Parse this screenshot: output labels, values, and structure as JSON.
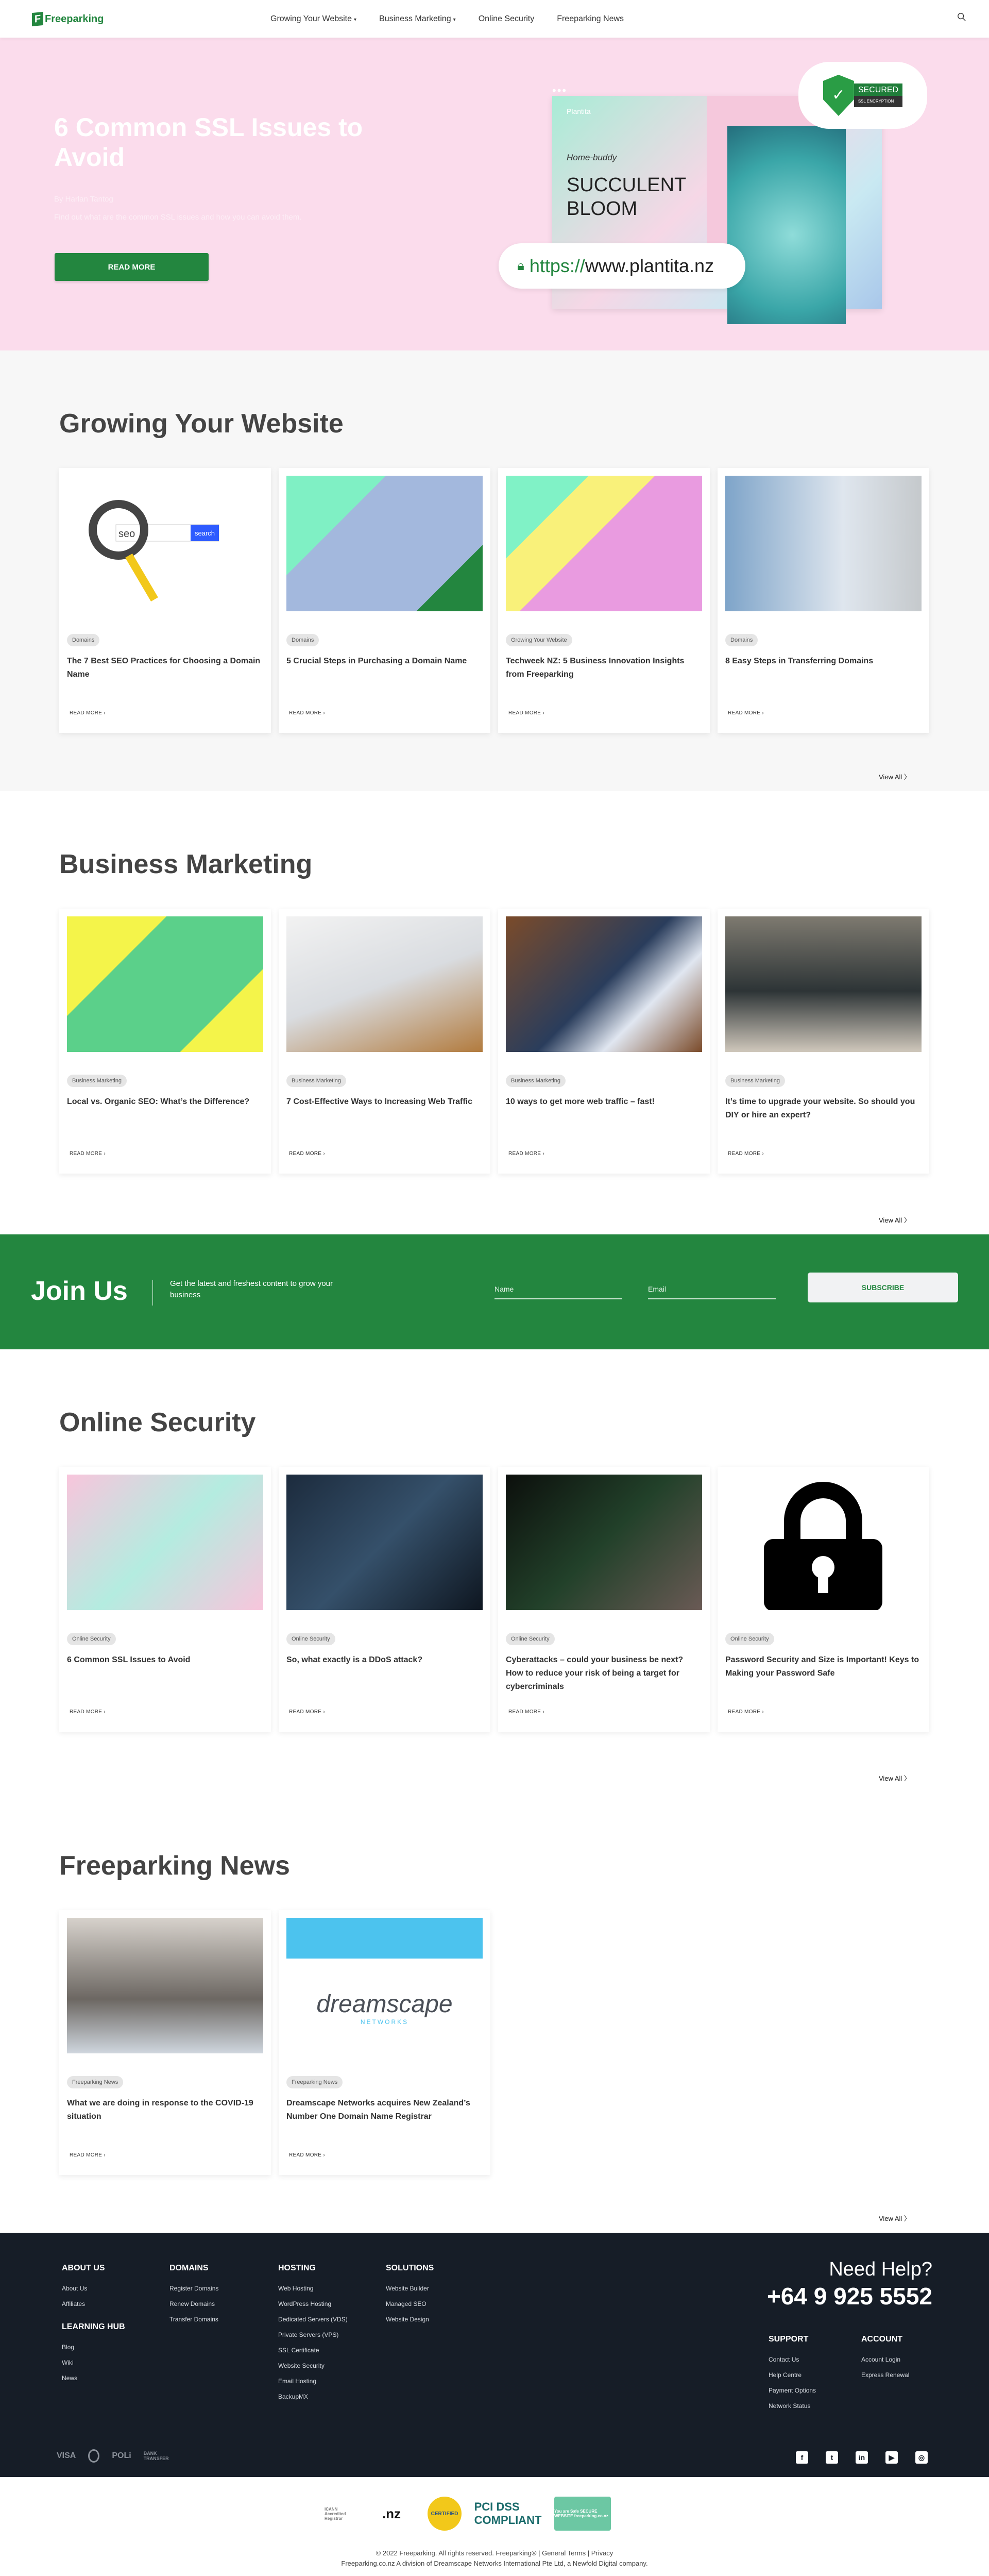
{
  "header": {
    "logo_mark": "F",
    "logo": "Freeparking",
    "nav": [
      {
        "label": "Growing Your Website",
        "dropdown": true
      },
      {
        "label": "Business Marketing",
        "dropdown": true
      },
      {
        "label": "Online Security",
        "dropdown": false
      },
      {
        "label": "Freeparking News",
        "dropdown": false
      }
    ],
    "search_icon": "search-icon"
  },
  "hero": {
    "title": "6 Common SSL Issues to Avoid",
    "author": "By Harlan Tantog",
    "description": "Find out what are the common SSL issues and how you can avoid them.",
    "button": "READ MORE",
    "image": {
      "brand": "Plantita",
      "tagline": "Home-buddy",
      "headline": "SUCCULENT BLOOM",
      "badge_title": "SECURED",
      "badge_sub": "SSL ENCRYPTION",
      "url_scheme": "https://",
      "url_host": "www.plantita.nz"
    }
  },
  "read_more": "READ MORE",
  "view_all": "View All",
  "sections": [
    {
      "title": "Growing Your Website",
      "cards": [
        {
          "tag": "Domains",
          "title": "The 7 Best SEO Practices for Choosing a Domain Name"
        },
        {
          "tag": "Domains",
          "title": "5 Crucial Steps in Purchasing a Domain Name"
        },
        {
          "tag": "Growing Your Website",
          "title": "Techweek NZ: 5 Business Innovation Insights from Freeparking"
        },
        {
          "tag": "Domains",
          "title": "8 Easy Steps in Transferring Domains"
        }
      ]
    },
    {
      "title": "Business Marketing",
      "cards": [
        {
          "tag": "Business Marketing",
          "title": "Local vs. Organic SEO: What’s the Difference?"
        },
        {
          "tag": "Business Marketing",
          "title": "7 Cost-Effective Ways to Increasing Web Traffic"
        },
        {
          "tag": "Business Marketing",
          "title": "10 ways to get more web traffic – fast!"
        },
        {
          "tag": "Business Marketing",
          "title": "It’s time to upgrade your website. So should you DIY or hire an expert?"
        }
      ]
    },
    {
      "title": "Online Security",
      "cards": [
        {
          "tag": "Online Security",
          "title": "6 Common SSL Issues to Avoid"
        },
        {
          "tag": "Online Security",
          "title": "So, what exactly is a DDoS attack?"
        },
        {
          "tag": "Online Security",
          "title": "Cyberattacks – could your business be next? How to reduce your risk of being a target for cybercriminals"
        },
        {
          "tag": "Online Security",
          "title": "Password Security and Size is Important! Keys to Making your Password Safe"
        }
      ]
    },
    {
      "title": "Freeparking News",
      "cards": [
        {
          "tag": "Freeparking News",
          "title": "What we are doing in response to the COVID-19 situation"
        },
        {
          "tag": "Freeparking News",
          "title": "Dreamscape Networks acquires New Zealand’s Number One Domain Name Registrar"
        }
      ]
    }
  ],
  "join": {
    "title": "Join Us",
    "subtitle": "Get the latest and freshest content to grow your business",
    "name_placeholder": "Name",
    "email_placeholder": "Email",
    "button": "SUBSCRIBE"
  },
  "footer": {
    "columns": [
      {
        "groups": [
          {
            "title": "ABOUT US",
            "links": [
              "About Us",
              "Affiliates"
            ]
          },
          {
            "title": "LEARNING HUB",
            "links": [
              "Blog",
              "Wiki",
              "News"
            ]
          }
        ]
      },
      {
        "groups": [
          {
            "title": "DOMAINS",
            "links": [
              "Register Domains",
              "Renew Domains",
              "Transfer Domains"
            ]
          }
        ]
      },
      {
        "groups": [
          {
            "title": "HOSTING",
            "links": [
              "Web Hosting",
              "WordPress Hosting",
              "Dedicated Servers (VDS)",
              "Private Servers (VPS)",
              "SSL Certificate",
              "Website Security",
              "Email Hosting",
              "BackupMX"
            ]
          }
        ]
      },
      {
        "groups": [
          {
            "title": "SOLUTIONS",
            "links": [
              "Website Builder",
              "Managed SEO",
              "Website Design"
            ]
          }
        ]
      }
    ],
    "need_help": "Need Help?",
    "phone": "+64 9 925 5552",
    "support": {
      "title": "SUPPORT",
      "links": [
        "Contact Us",
        "Help Centre",
        "Payment Options",
        "Network Status"
      ]
    },
    "account": {
      "title": "ACCOUNT",
      "links": [
        "Account Login",
        "Express Renewal"
      ]
    },
    "payments": [
      "VISA",
      "mastercard-icon",
      "POLi",
      "BANK TRANSFER"
    ],
    "social": [
      "facebook-icon",
      "twitter-icon",
      "linkedin-icon",
      "youtube-icon",
      "instagram-icon"
    ]
  },
  "badges": [
    "ICANN Accredited Registrar",
    ".nz",
    "CERTIFIED",
    "PCI DSS COMPLIANT",
    "You are Safe SECURE WEBSITE freeparking.co.nz"
  ],
  "copyright": "© 2022 Freeparking. All rights reserved. Freeparking® | General Terms | Privacy",
  "division": "Freeparking.co.nz A division of Dreamscape Networks International Pte Ltd, a Newfold Digital company.",
  "colors": {
    "brand": "#23863f",
    "hero_bg": "#fbdcec",
    "footer_bg": "#161d27"
  }
}
